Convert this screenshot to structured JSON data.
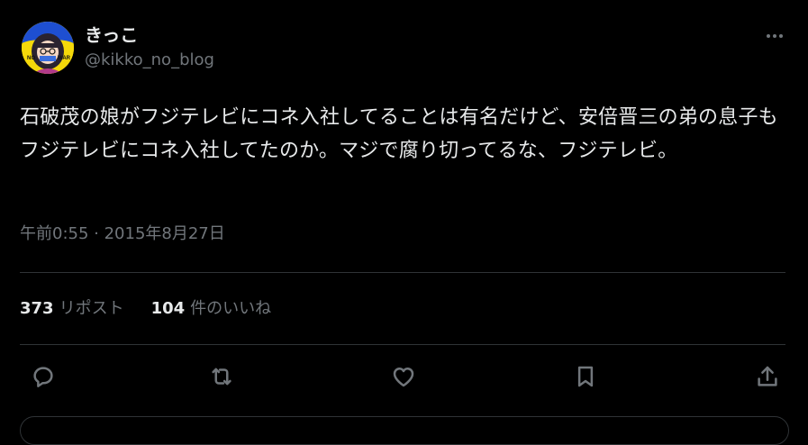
{
  "user": {
    "display_name": "きっこ",
    "handle": "@kikko_no_blog",
    "avatar_text_left": "NO",
    "avatar_text_right": "WAR"
  },
  "tweet": {
    "text": "石破茂の娘がフジテレビにコネ入社してることは有名だけど、安倍晋三の弟の息子もフジテレビにコネ入社してたのか。マジで腐り切ってるな、フジテレビ。",
    "timestamp": "午前0:55 · 2015年8月27日"
  },
  "stats": {
    "reposts_count": "373",
    "reposts_label": "リポスト",
    "likes_count": "104",
    "likes_label": "件のいいね"
  },
  "icons": {
    "more": "more-horizontal-icon",
    "reply": "reply-icon",
    "repost": "repost-icon",
    "like": "heart-icon",
    "bookmark": "bookmark-icon",
    "share": "share-icon"
  },
  "colors": {
    "background": "#000000",
    "text_primary": "#e7e9ea",
    "text_secondary": "#71767b",
    "divider": "#2f3336",
    "avatar_yellow": "#f5d90a",
    "avatar_blue": "#1e4fd1"
  }
}
